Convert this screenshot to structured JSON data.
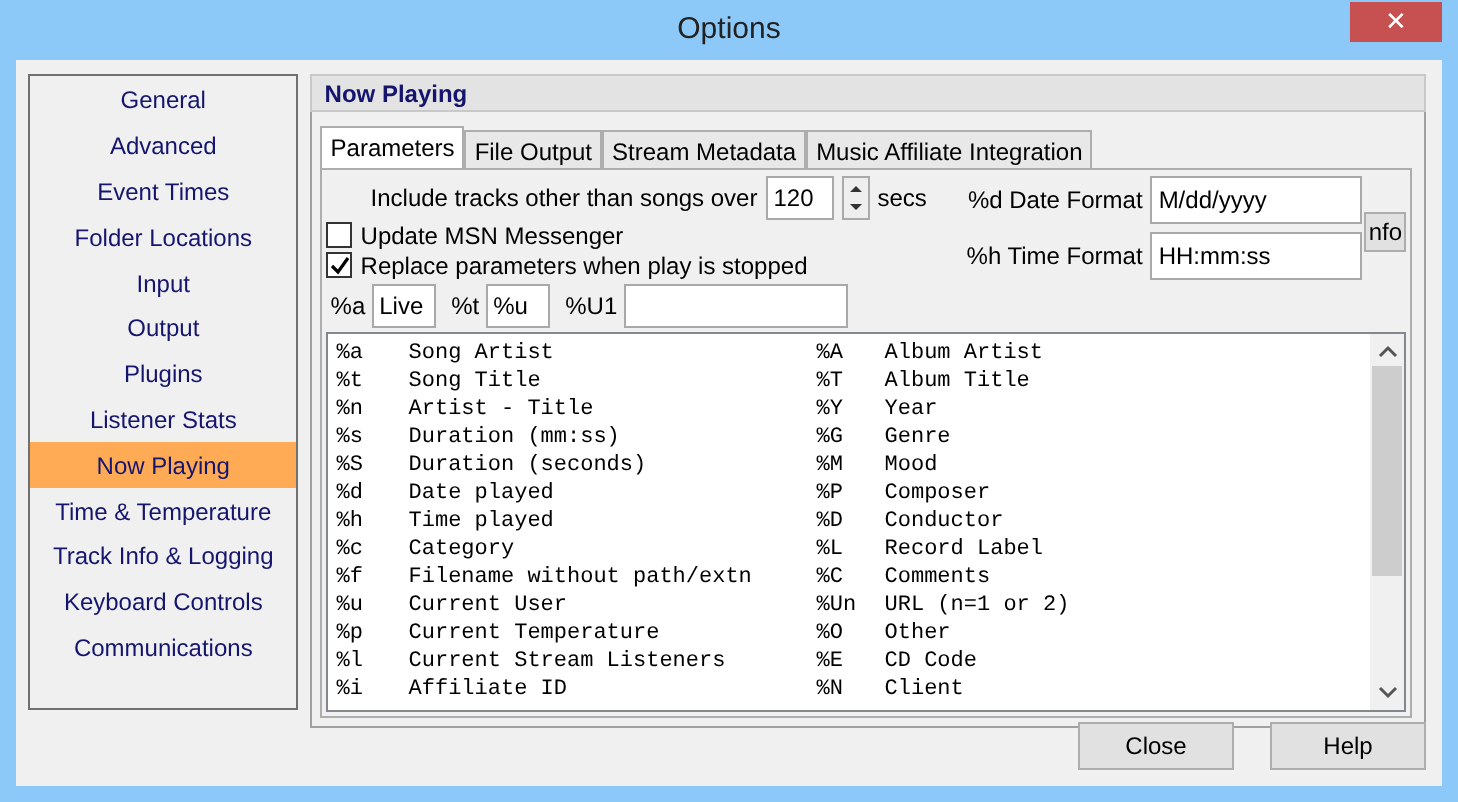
{
  "window": {
    "title": "Options",
    "close": "✕"
  },
  "sidebar": {
    "items": [
      {
        "label": "General",
        "selected": false
      },
      {
        "label": "Advanced",
        "selected": false
      },
      {
        "label": "Event Times",
        "selected": false
      },
      {
        "label": "Folder Locations",
        "selected": false
      },
      {
        "label": "Input",
        "selected": false
      },
      {
        "label": "Output",
        "selected": false
      },
      {
        "label": "Plugins",
        "selected": false
      },
      {
        "label": "Listener Stats",
        "selected": false
      },
      {
        "label": "Now Playing",
        "selected": true
      },
      {
        "label": "Time & Temperature",
        "selected": false
      },
      {
        "label": "Track Info & Logging",
        "selected": false
      },
      {
        "label": "Keyboard Controls",
        "selected": false
      },
      {
        "label": "Communications",
        "selected": false
      }
    ]
  },
  "panel": {
    "title": "Now Playing",
    "tabs": [
      {
        "label": "Parameters",
        "selected": true
      },
      {
        "label": "File Output",
        "selected": false
      },
      {
        "label": "Stream Metadata",
        "selected": false
      },
      {
        "label": "Music Affiliate Integration",
        "selected": false
      }
    ],
    "include": {
      "label": "Include tracks other than songs over",
      "value": "120",
      "unit": "secs"
    },
    "checkboxes": [
      {
        "label": "Update MSN Messenger",
        "checked": false
      },
      {
        "label": "Replace parameters when play is stopped",
        "checked": true
      }
    ],
    "formats": [
      {
        "label": "%d Date Format",
        "value": "M/dd/yyyy"
      },
      {
        "label": "%h Time Format",
        "value": "HH:mm:ss"
      }
    ],
    "info_button": "nfo",
    "params": [
      {
        "label": "%a",
        "value": "Live"
      },
      {
        "label": "%t",
        "value": "%u"
      },
      {
        "label": "%U1"
      }
    ],
    "list": [
      {
        "code": "%a",
        "text": "Song Artist",
        "code_2": "%A",
        "text_2": "Album Artist"
      },
      {
        "code": "%t",
        "text": "Song Title",
        "code_2": "%T",
        "text_2": "Album Title"
      },
      {
        "code": "%n",
        "text": "Artist - Title",
        "code_2": "%Y",
        "text_2": "Year"
      },
      {
        "code": "%s",
        "text": "Duration (mm:ss)",
        "code_2": "%G",
        "text_2": "Genre"
      },
      {
        "code": "%S",
        "text": "Duration (seconds)",
        "code_2": "%M",
        "text_2": "Mood"
      },
      {
        "code": "%d",
        "text": "Date played",
        "code_2": "%P",
        "text_2": "Composer"
      },
      {
        "code": "%h",
        "text": "Time played",
        "code_2": "%D",
        "text_2": "Conductor"
      },
      {
        "code": "%c",
        "text": "Category",
        "code_2": "%L",
        "text_2": "Record Label"
      },
      {
        "code": "%f",
        "text": "Filename without path/extn",
        "code_2": "%C",
        "text_2": "Comments"
      },
      {
        "code": "%u",
        "text": "Current User",
        "code_2": "%Un",
        "text_2": "URL (n=1 or 2)"
      },
      {
        "code": "%p",
        "text": "Current Temperature",
        "code_2": "%O",
        "text_2": "Other"
      },
      {
        "code": "%l",
        "text": "Current Stream Listeners",
        "code_2": "%E",
        "text_2": "CD Code"
      },
      {
        "code": "%i",
        "text": "Affiliate ID",
        "code_2": "%N",
        "text_2": "Client"
      }
    ]
  },
  "buttons": [
    "Close",
    "Help"
  ]
}
